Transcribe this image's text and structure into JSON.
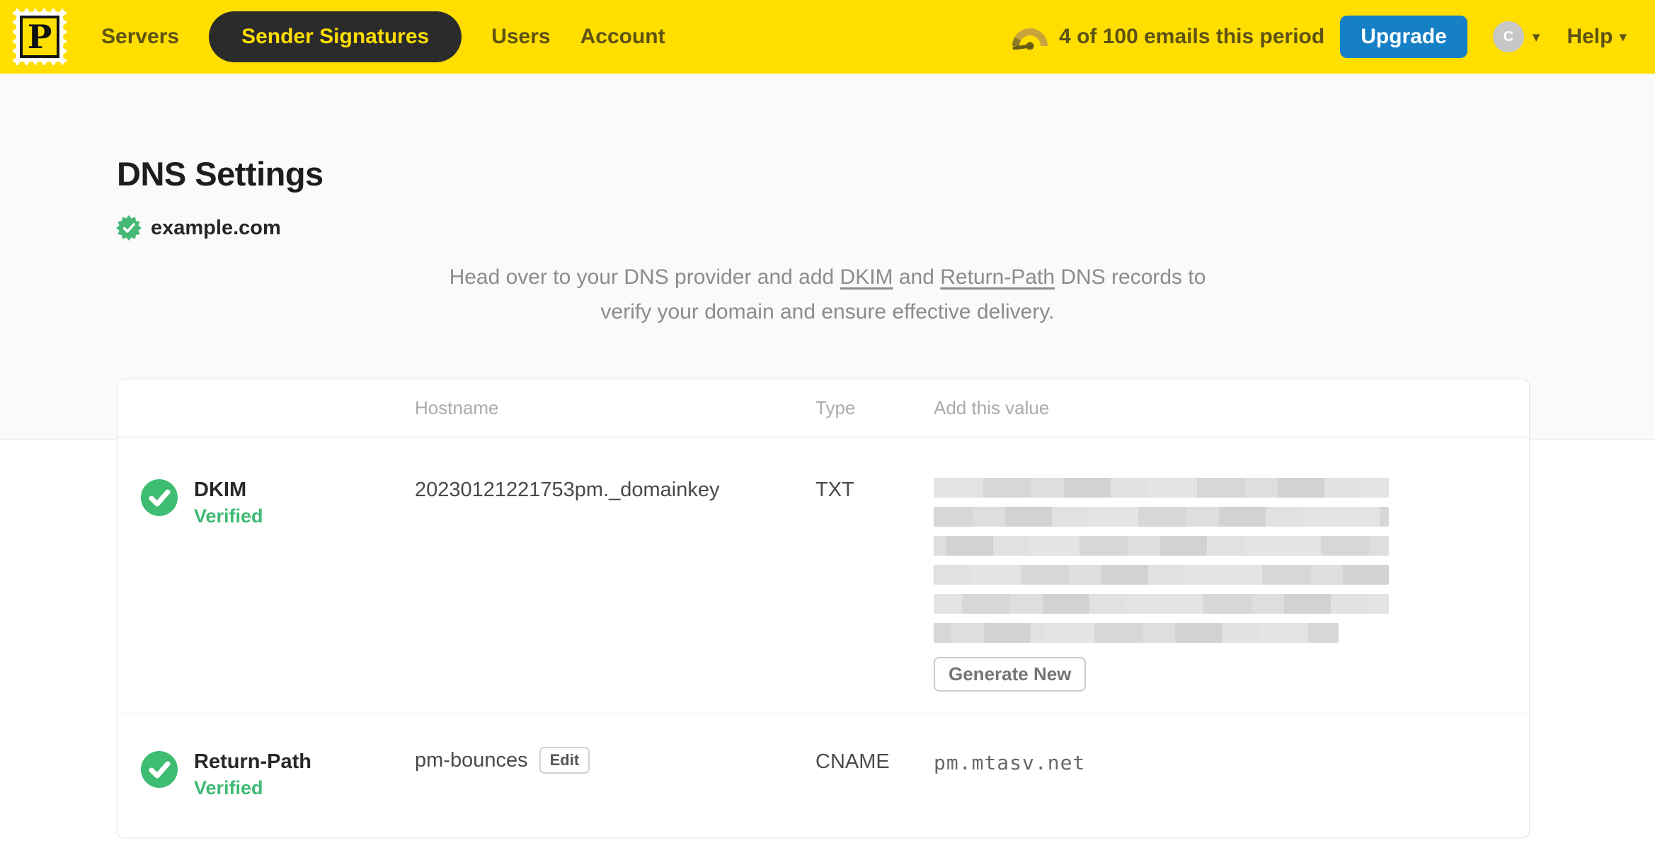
{
  "nav": {
    "logo_letter": "P",
    "items": [
      {
        "label": "Servers"
      },
      {
        "label": "Sender Signatures"
      },
      {
        "label": "Users"
      },
      {
        "label": "Account"
      }
    ],
    "usage_text": "4 of 100 emails this period",
    "upgrade_label": "Upgrade",
    "avatar_letter": "C",
    "help_label": "Help"
  },
  "page": {
    "title": "DNS Settings",
    "domain": "example.com",
    "intro_pre": "Head over to your DNS provider and add ",
    "intro_link_dkim": "DKIM",
    "intro_mid": " and ",
    "intro_link_return_path": "Return-Path",
    "intro_line1_end": " DNS records to",
    "intro_line2": "verify your domain and ensure effective delivery."
  },
  "table": {
    "headers": {
      "hostname": "Hostname",
      "type": "Type",
      "value": "Add this value"
    },
    "dkim_row": {
      "name": "DKIM",
      "status": "Verified",
      "hostname": "20230121221753pm._domainkey",
      "type": "TXT",
      "value_redacted_bar_widths_pct": [
        100,
        100,
        100,
        100,
        100,
        89
      ],
      "generate_button": "Generate New"
    },
    "return_path_row": {
      "name": "Return-Path",
      "status": "Verified",
      "hostname": "pm-bounces",
      "edit_button": "Edit",
      "type": "CNAME",
      "value": "pm.mtasv.net"
    }
  },
  "colors": {
    "brand_yellow": "#FFDE00",
    "nav_text": "#5E5212",
    "active_pill_bg": "#2B2B2B",
    "active_pill_text": "#FFDE00",
    "upgrade_blue": "#1580C6",
    "verified_green": "#3FBA74",
    "intro_gray": "#8C8C8C"
  }
}
